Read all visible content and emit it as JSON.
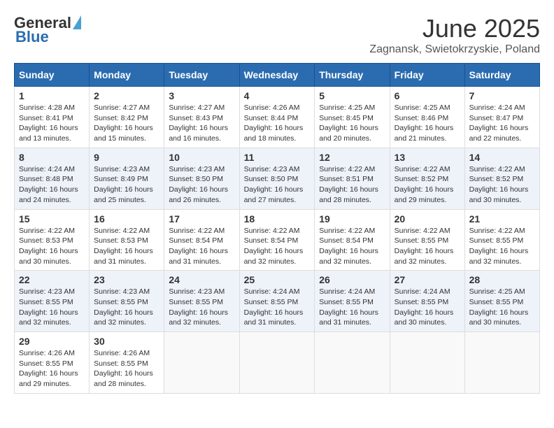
{
  "header": {
    "logo_general": "General",
    "logo_blue": "Blue",
    "title": "June 2025",
    "subtitle": "Zagnansk, Swietokrzyskie, Poland"
  },
  "calendar": {
    "days_of_week": [
      "Sunday",
      "Monday",
      "Tuesday",
      "Wednesday",
      "Thursday",
      "Friday",
      "Saturday"
    ],
    "weeks": [
      [
        null,
        {
          "day": "2",
          "sunrise": "4:27 AM",
          "sunset": "8:42 PM",
          "daylight": "16 hours and 15 minutes."
        },
        {
          "day": "3",
          "sunrise": "4:27 AM",
          "sunset": "8:43 PM",
          "daylight": "16 hours and 16 minutes."
        },
        {
          "day": "4",
          "sunrise": "4:26 AM",
          "sunset": "8:44 PM",
          "daylight": "16 hours and 18 minutes."
        },
        {
          "day": "5",
          "sunrise": "4:25 AM",
          "sunset": "8:45 PM",
          "daylight": "16 hours and 20 minutes."
        },
        {
          "day": "6",
          "sunrise": "4:25 AM",
          "sunset": "8:46 PM",
          "daylight": "16 hours and 21 minutes."
        },
        {
          "day": "7",
          "sunrise": "4:24 AM",
          "sunset": "8:47 PM",
          "daylight": "16 hours and 22 minutes."
        }
      ],
      [
        {
          "day": "1",
          "sunrise": "4:28 AM",
          "sunset": "8:41 PM",
          "daylight": "16 hours and 13 minutes."
        },
        {
          "day": "9",
          "sunrise": "4:23 AM",
          "sunset": "8:49 PM",
          "daylight": "16 hours and 25 minutes."
        },
        {
          "day": "10",
          "sunrise": "4:23 AM",
          "sunset": "8:50 PM",
          "daylight": "16 hours and 26 minutes."
        },
        {
          "day": "11",
          "sunrise": "4:23 AM",
          "sunset": "8:50 PM",
          "daylight": "16 hours and 27 minutes."
        },
        {
          "day": "12",
          "sunrise": "4:22 AM",
          "sunset": "8:51 PM",
          "daylight": "16 hours and 28 minutes."
        },
        {
          "day": "13",
          "sunrise": "4:22 AM",
          "sunset": "8:52 PM",
          "daylight": "16 hours and 29 minutes."
        },
        {
          "day": "14",
          "sunrise": "4:22 AM",
          "sunset": "8:52 PM",
          "daylight": "16 hours and 30 minutes."
        }
      ],
      [
        {
          "day": "8",
          "sunrise": "4:24 AM",
          "sunset": "8:48 PM",
          "daylight": "16 hours and 24 minutes."
        },
        {
          "day": "16",
          "sunrise": "4:22 AM",
          "sunset": "8:53 PM",
          "daylight": "16 hours and 31 minutes."
        },
        {
          "day": "17",
          "sunrise": "4:22 AM",
          "sunset": "8:54 PM",
          "daylight": "16 hours and 31 minutes."
        },
        {
          "day": "18",
          "sunrise": "4:22 AM",
          "sunset": "8:54 PM",
          "daylight": "16 hours and 32 minutes."
        },
        {
          "day": "19",
          "sunrise": "4:22 AM",
          "sunset": "8:54 PM",
          "daylight": "16 hours and 32 minutes."
        },
        {
          "day": "20",
          "sunrise": "4:22 AM",
          "sunset": "8:55 PM",
          "daylight": "16 hours and 32 minutes."
        },
        {
          "day": "21",
          "sunrise": "4:22 AM",
          "sunset": "8:55 PM",
          "daylight": "16 hours and 32 minutes."
        }
      ],
      [
        {
          "day": "15",
          "sunrise": "4:22 AM",
          "sunset": "8:53 PM",
          "daylight": "16 hours and 30 minutes."
        },
        {
          "day": "23",
          "sunrise": "4:23 AM",
          "sunset": "8:55 PM",
          "daylight": "16 hours and 32 minutes."
        },
        {
          "day": "24",
          "sunrise": "4:23 AM",
          "sunset": "8:55 PM",
          "daylight": "16 hours and 32 minutes."
        },
        {
          "day": "25",
          "sunrise": "4:24 AM",
          "sunset": "8:55 PM",
          "daylight": "16 hours and 31 minutes."
        },
        {
          "day": "26",
          "sunrise": "4:24 AM",
          "sunset": "8:55 PM",
          "daylight": "16 hours and 31 minutes."
        },
        {
          "day": "27",
          "sunrise": "4:24 AM",
          "sunset": "8:55 PM",
          "daylight": "16 hours and 30 minutes."
        },
        {
          "day": "28",
          "sunrise": "4:25 AM",
          "sunset": "8:55 PM",
          "daylight": "16 hours and 30 minutes."
        }
      ],
      [
        {
          "day": "22",
          "sunrise": "4:23 AM",
          "sunset": "8:55 PM",
          "daylight": "16 hours and 32 minutes."
        },
        {
          "day": "30",
          "sunrise": "4:26 AM",
          "sunset": "8:55 PM",
          "daylight": "16 hours and 28 minutes."
        },
        null,
        null,
        null,
        null,
        null
      ],
      [
        {
          "day": "29",
          "sunrise": "4:26 AM",
          "sunset": "8:55 PM",
          "daylight": "16 hours and 29 minutes."
        },
        null,
        null,
        null,
        null,
        null,
        null
      ]
    ]
  }
}
